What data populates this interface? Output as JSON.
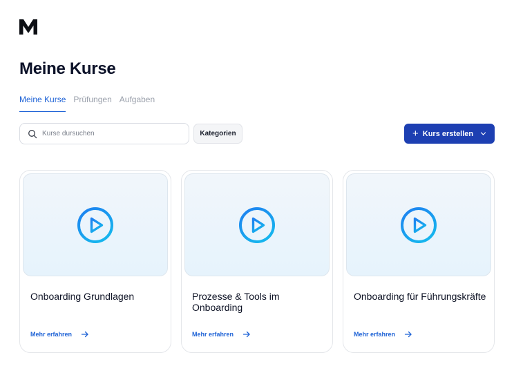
{
  "app": {
    "logo_icon": "m-logo-icon"
  },
  "page": {
    "title": "Meine Kurse"
  },
  "tabs": [
    {
      "label": "Meine Kurse",
      "active": true
    },
    {
      "label": "Prüfungen",
      "active": false
    },
    {
      "label": "Aufgaben",
      "active": false
    }
  ],
  "toolbar": {
    "search_placeholder": "Kurse dursuchen",
    "search_icon": "search-icon",
    "categories_label": "Kategorien",
    "create_label": "Kurs erstellen",
    "create_icon": "plus-icon",
    "create_chevron_icon": "chevron-down-icon"
  },
  "courses": [
    {
      "title": "Onboarding Grundlagen",
      "link": "Mehr erfahren",
      "thumb_icon": "play-circle-icon"
    },
    {
      "title": "Prozesse & Tools im Onboarding",
      "link": "Mehr erfahren",
      "thumb_icon": "play-circle-icon"
    },
    {
      "title": "Onboarding für Führungskräfte",
      "link": "Mehr erfahren",
      "thumb_icon": "play-circle-icon"
    }
  ],
  "colors": {
    "accent": "#1f63d6",
    "primary_button": "#1d3fb2",
    "title": "#0b1128",
    "inactive_tab": "#9aa0ab",
    "play_gradient_start": "#1e7ff0",
    "play_gradient_end": "#16b4ee"
  }
}
